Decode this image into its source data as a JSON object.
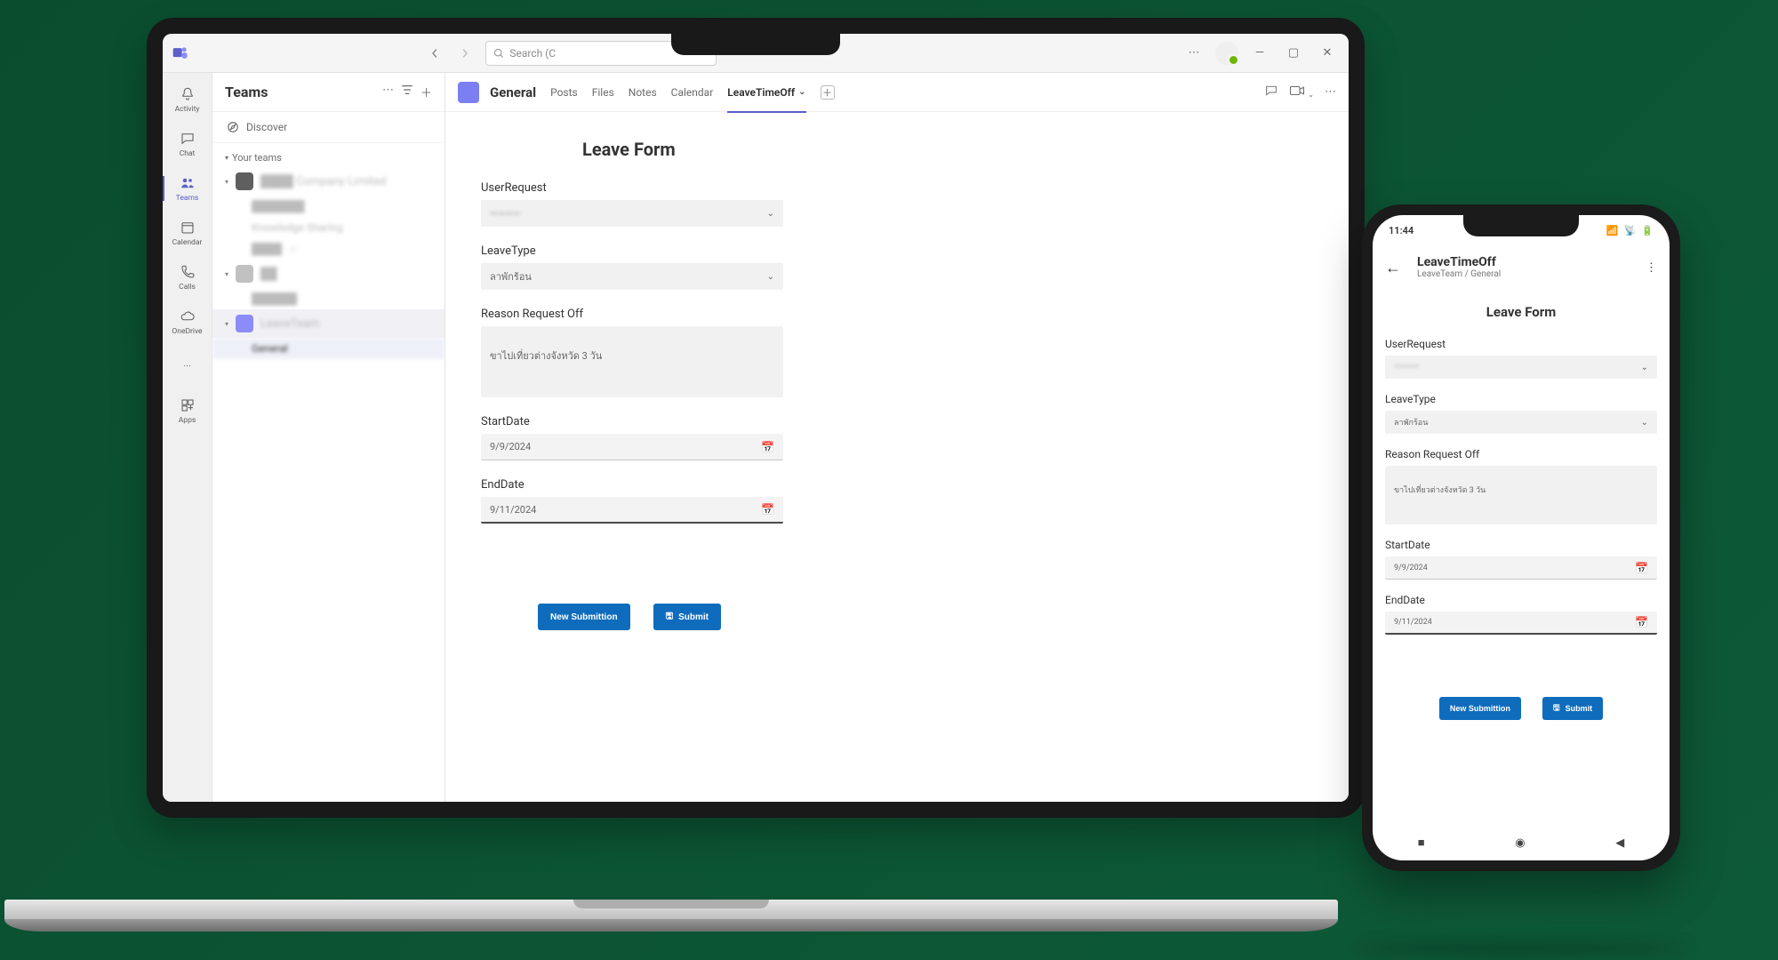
{
  "titlebar": {
    "search_placeholder": "Search (C",
    "nav_prev": "‹",
    "nav_next": "›"
  },
  "rail": {
    "items": [
      {
        "label": "Activity",
        "icon": "bell-icon"
      },
      {
        "label": "Chat",
        "icon": "chat-icon"
      },
      {
        "label": "Teams",
        "icon": "teams-icon"
      },
      {
        "label": "Calendar",
        "icon": "calendar-icon"
      },
      {
        "label": "Calls",
        "icon": "calls-icon"
      },
      {
        "label": "OneDrive",
        "icon": "cloud-icon"
      },
      {
        "label": "",
        "icon": "ellipsis-icon"
      },
      {
        "label": "Apps",
        "icon": "apps-icon"
      }
    ]
  },
  "panel": {
    "title": "Teams",
    "discover": "Discover",
    "group": "Your teams"
  },
  "stage": {
    "channel_name": "General",
    "tabs": [
      {
        "label": "Posts"
      },
      {
        "label": "Files"
      },
      {
        "label": "Notes"
      },
      {
        "label": "Calendar"
      },
      {
        "label": "LeaveTimeOff"
      }
    ]
  },
  "form": {
    "title": "Leave Form",
    "user_request_label": "UserRequest",
    "user_request_value": "————",
    "leave_type_label": "LeaveType",
    "leave_type_value": "ลาพักร้อน",
    "reason_label": "Reason Request Off",
    "reason_value": "ขาไปเที่ยวต่างจังหวัด 3 วัน",
    "start_label": "StartDate",
    "start_value": "9/9/2024",
    "end_label": "EndDate",
    "end_value": "9/11/2024",
    "new_submission": "New Submittion",
    "submit": "Submit"
  },
  "phone": {
    "time": "11:44",
    "app_title": "LeaveTimeOff",
    "app_subtitle": "LeaveTeam / General"
  }
}
